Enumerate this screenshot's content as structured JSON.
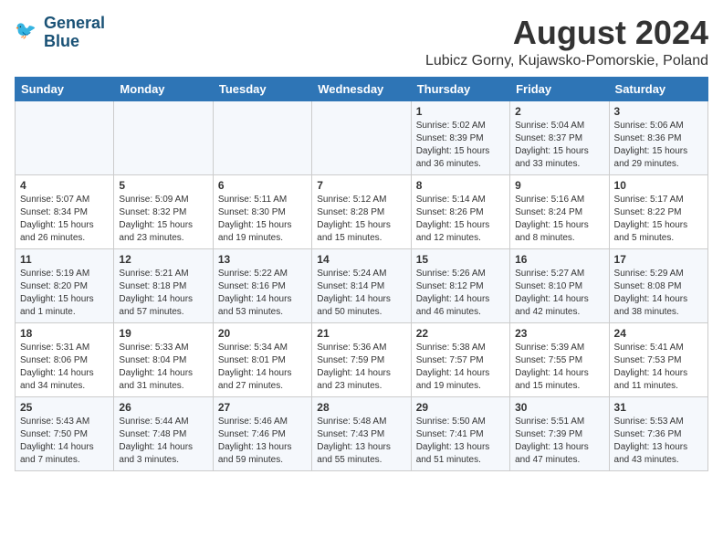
{
  "header": {
    "logo_line1": "General",
    "logo_line2": "Blue",
    "month_year": "August 2024",
    "location": "Lubicz Gorny, Kujawsko-Pomorskie, Poland"
  },
  "days_of_week": [
    "Sunday",
    "Monday",
    "Tuesday",
    "Wednesday",
    "Thursday",
    "Friday",
    "Saturday"
  ],
  "weeks": [
    [
      {
        "day": "",
        "info": ""
      },
      {
        "day": "",
        "info": ""
      },
      {
        "day": "",
        "info": ""
      },
      {
        "day": "",
        "info": ""
      },
      {
        "day": "1",
        "info": "Sunrise: 5:02 AM\nSunset: 8:39 PM\nDaylight: 15 hours\nand 36 minutes."
      },
      {
        "day": "2",
        "info": "Sunrise: 5:04 AM\nSunset: 8:37 PM\nDaylight: 15 hours\nand 33 minutes."
      },
      {
        "day": "3",
        "info": "Sunrise: 5:06 AM\nSunset: 8:36 PM\nDaylight: 15 hours\nand 29 minutes."
      }
    ],
    [
      {
        "day": "4",
        "info": "Sunrise: 5:07 AM\nSunset: 8:34 PM\nDaylight: 15 hours\nand 26 minutes."
      },
      {
        "day": "5",
        "info": "Sunrise: 5:09 AM\nSunset: 8:32 PM\nDaylight: 15 hours\nand 23 minutes."
      },
      {
        "day": "6",
        "info": "Sunrise: 5:11 AM\nSunset: 8:30 PM\nDaylight: 15 hours\nand 19 minutes."
      },
      {
        "day": "7",
        "info": "Sunrise: 5:12 AM\nSunset: 8:28 PM\nDaylight: 15 hours\nand 15 minutes."
      },
      {
        "day": "8",
        "info": "Sunrise: 5:14 AM\nSunset: 8:26 PM\nDaylight: 15 hours\nand 12 minutes."
      },
      {
        "day": "9",
        "info": "Sunrise: 5:16 AM\nSunset: 8:24 PM\nDaylight: 15 hours\nand 8 minutes."
      },
      {
        "day": "10",
        "info": "Sunrise: 5:17 AM\nSunset: 8:22 PM\nDaylight: 15 hours\nand 5 minutes."
      }
    ],
    [
      {
        "day": "11",
        "info": "Sunrise: 5:19 AM\nSunset: 8:20 PM\nDaylight: 15 hours\nand 1 minute."
      },
      {
        "day": "12",
        "info": "Sunrise: 5:21 AM\nSunset: 8:18 PM\nDaylight: 14 hours\nand 57 minutes."
      },
      {
        "day": "13",
        "info": "Sunrise: 5:22 AM\nSunset: 8:16 PM\nDaylight: 14 hours\nand 53 minutes."
      },
      {
        "day": "14",
        "info": "Sunrise: 5:24 AM\nSunset: 8:14 PM\nDaylight: 14 hours\nand 50 minutes."
      },
      {
        "day": "15",
        "info": "Sunrise: 5:26 AM\nSunset: 8:12 PM\nDaylight: 14 hours\nand 46 minutes."
      },
      {
        "day": "16",
        "info": "Sunrise: 5:27 AM\nSunset: 8:10 PM\nDaylight: 14 hours\nand 42 minutes."
      },
      {
        "day": "17",
        "info": "Sunrise: 5:29 AM\nSunset: 8:08 PM\nDaylight: 14 hours\nand 38 minutes."
      }
    ],
    [
      {
        "day": "18",
        "info": "Sunrise: 5:31 AM\nSunset: 8:06 PM\nDaylight: 14 hours\nand 34 minutes."
      },
      {
        "day": "19",
        "info": "Sunrise: 5:33 AM\nSunset: 8:04 PM\nDaylight: 14 hours\nand 31 minutes."
      },
      {
        "day": "20",
        "info": "Sunrise: 5:34 AM\nSunset: 8:01 PM\nDaylight: 14 hours\nand 27 minutes."
      },
      {
        "day": "21",
        "info": "Sunrise: 5:36 AM\nSunset: 7:59 PM\nDaylight: 14 hours\nand 23 minutes."
      },
      {
        "day": "22",
        "info": "Sunrise: 5:38 AM\nSunset: 7:57 PM\nDaylight: 14 hours\nand 19 minutes."
      },
      {
        "day": "23",
        "info": "Sunrise: 5:39 AM\nSunset: 7:55 PM\nDaylight: 14 hours\nand 15 minutes."
      },
      {
        "day": "24",
        "info": "Sunrise: 5:41 AM\nSunset: 7:53 PM\nDaylight: 14 hours\nand 11 minutes."
      }
    ],
    [
      {
        "day": "25",
        "info": "Sunrise: 5:43 AM\nSunset: 7:50 PM\nDaylight: 14 hours\nand 7 minutes."
      },
      {
        "day": "26",
        "info": "Sunrise: 5:44 AM\nSunset: 7:48 PM\nDaylight: 14 hours\nand 3 minutes."
      },
      {
        "day": "27",
        "info": "Sunrise: 5:46 AM\nSunset: 7:46 PM\nDaylight: 13 hours\nand 59 minutes."
      },
      {
        "day": "28",
        "info": "Sunrise: 5:48 AM\nSunset: 7:43 PM\nDaylight: 13 hours\nand 55 minutes."
      },
      {
        "day": "29",
        "info": "Sunrise: 5:50 AM\nSunset: 7:41 PM\nDaylight: 13 hours\nand 51 minutes."
      },
      {
        "day": "30",
        "info": "Sunrise: 5:51 AM\nSunset: 7:39 PM\nDaylight: 13 hours\nand 47 minutes."
      },
      {
        "day": "31",
        "info": "Sunrise: 5:53 AM\nSunset: 7:36 PM\nDaylight: 13 hours\nand 43 minutes."
      }
    ]
  ]
}
